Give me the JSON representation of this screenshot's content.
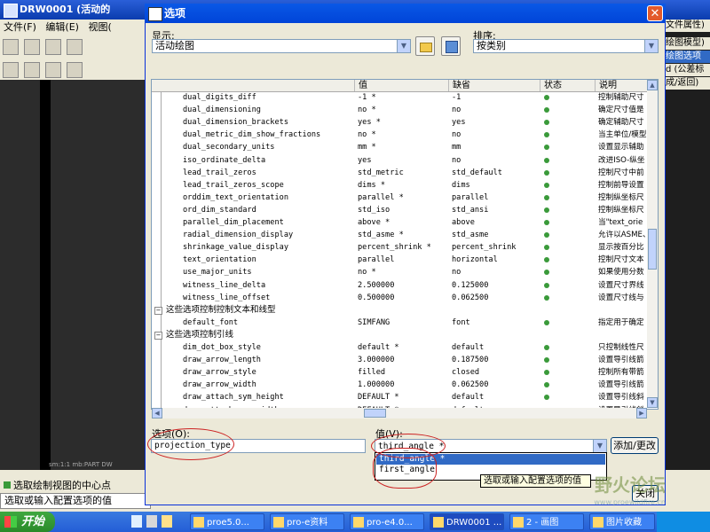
{
  "background_app": {
    "title": "DRW0001 (活动的",
    "menu": [
      "文件(F)",
      "编辑(E)",
      "视图("
    ],
    "right_panel": [
      "文件属性)",
      "绘图模型)",
      "绘图选项",
      "d (公差标",
      "成/返回)"
    ],
    "coords": "sm:1:1  mb:PART  DW",
    "status_line1": "选取绘制视图的中心点",
    "status_line2": "选取或输入配置选项的值"
  },
  "dialog": {
    "title": "选项",
    "close_glyph": "✕",
    "show_label": "显示:",
    "show_value": "活动绘图",
    "sort_label": "排序:",
    "sort_value": "按类别",
    "columns": {
      "name": "",
      "value": "值",
      "default": "缺省",
      "status": "状态",
      "description": "说明"
    },
    "rows": [
      {
        "name": "dual_digits_diff",
        "value": "-1 *",
        "default": "-1",
        "status": "active",
        "description": "控制辅助尺寸"
      },
      {
        "name": "dual_dimensioning",
        "value": "no *",
        "default": "no",
        "status": "active",
        "description": "确定尺寸值是"
      },
      {
        "name": "dual_dimension_brackets",
        "value": "yes *",
        "default": "yes",
        "status": "active",
        "description": "确定辅助尺寸"
      },
      {
        "name": "dual_metric_dim_show_fractions",
        "value": "no *",
        "default": "no",
        "status": "active",
        "description": "当主单位/模型"
      },
      {
        "name": "dual_secondary_units",
        "value": "mm *",
        "default": "mm",
        "status": "active",
        "description": "设置显示辅助"
      },
      {
        "name": "iso_ordinate_delta",
        "value": "yes",
        "default": "no",
        "status": "active",
        "description": "改进ISO-纵坐"
      },
      {
        "name": "lead_trail_zeros",
        "value": "std_metric",
        "default": "std_default",
        "status": "active",
        "description": "控制尺寸中前"
      },
      {
        "name": "lead_trail_zeros_scope",
        "value": "dims *",
        "default": "dims",
        "status": "active",
        "description": "控制前导设置"
      },
      {
        "name": "orddim_text_orientation",
        "value": "parallel *",
        "default": "parallel",
        "status": "active",
        "description": "控制纵坐标尺"
      },
      {
        "name": "ord_dim_standard",
        "value": "std_iso",
        "default": "std_ansi",
        "status": "active",
        "description": "控制纵坐标尺"
      },
      {
        "name": "parallel_dim_placement",
        "value": "above *",
        "default": "above",
        "status": "active",
        "description": "当\"text_orie"
      },
      {
        "name": "radial_dimension_display",
        "value": "std_asme *",
        "default": "std_asme",
        "status": "active",
        "description": "允许以ASME、"
      },
      {
        "name": "shrinkage_value_display",
        "value": "percent_shrink *",
        "default": "percent_shrink",
        "status": "active",
        "description": "显示按百分比"
      },
      {
        "name": "text_orientation",
        "value": "parallel",
        "default": "horizontal",
        "status": "active",
        "description": "控制尺寸文本"
      },
      {
        "name": "use_major_units",
        "value": "no *",
        "default": "no",
        "status": "active",
        "description": "如果使用分数"
      },
      {
        "name": "witness_line_delta",
        "value": "2.500000",
        "default": "0.125000",
        "status": "active",
        "description": "设置尺寸界线"
      },
      {
        "name": "witness_line_offset",
        "value": "0.500000",
        "default": "0.062500",
        "status": "active",
        "description": "设置尺寸线与"
      },
      {
        "group": "这些选项控制控制文本和线型"
      },
      {
        "name": "default_font",
        "value": "SIMFANG",
        "default": "font",
        "status": "active",
        "description": "指定用于确定"
      },
      {
        "group": "这些选项控制引线"
      },
      {
        "name": "dim_dot_box_style",
        "value": "default *",
        "default": "default",
        "status": "active",
        "description": "只控制线性尺"
      },
      {
        "name": "draw_arrow_length",
        "value": "3.000000",
        "default": "0.187500",
        "status": "active",
        "description": "设置导引线箭"
      },
      {
        "name": "draw_arrow_style",
        "value": "filled",
        "default": "closed",
        "status": "active",
        "description": "控制所有带箭"
      },
      {
        "name": "draw_arrow_width",
        "value": "1.000000",
        "default": "0.062500",
        "status": "active",
        "description": "设置导引线箭"
      },
      {
        "name": "draw_attach_sym_height",
        "value": "DEFAULT *",
        "default": "default",
        "status": "active",
        "description": "设置导引线斜"
      },
      {
        "name": "draw_attach_sym_width",
        "value": "DEFAULT *",
        "default": "default",
        "status": "active",
        "description": "设置导引线斜"
      }
    ],
    "option_label": "选项(O):",
    "option_value": "projection_type",
    "value_label": "值(V):",
    "value_value": "third_angle *",
    "apply_label": "添加/更改",
    "dropdown_options": [
      "third_angle *",
      "first_angle"
    ],
    "selected_option": "third_angle *",
    "tooltip": "选取或输入配置选项的值",
    "close_label": "关闭"
  },
  "taskbar": {
    "start_label": "开始",
    "tasks": [
      "proe5.0...",
      "pro-e资料",
      "pro-e4.0...",
      "DRW0001 ...",
      "2 - 画图",
      "图片收藏"
    ]
  },
  "watermark": {
    "text": "野火论坛",
    "sub": "www.proewildfire.cn"
  },
  "colors": {
    "titlebar": "#0a58e6",
    "selection": "#316ac5",
    "status_ok": "#3a9a3a",
    "annotation": "#cc2222"
  }
}
